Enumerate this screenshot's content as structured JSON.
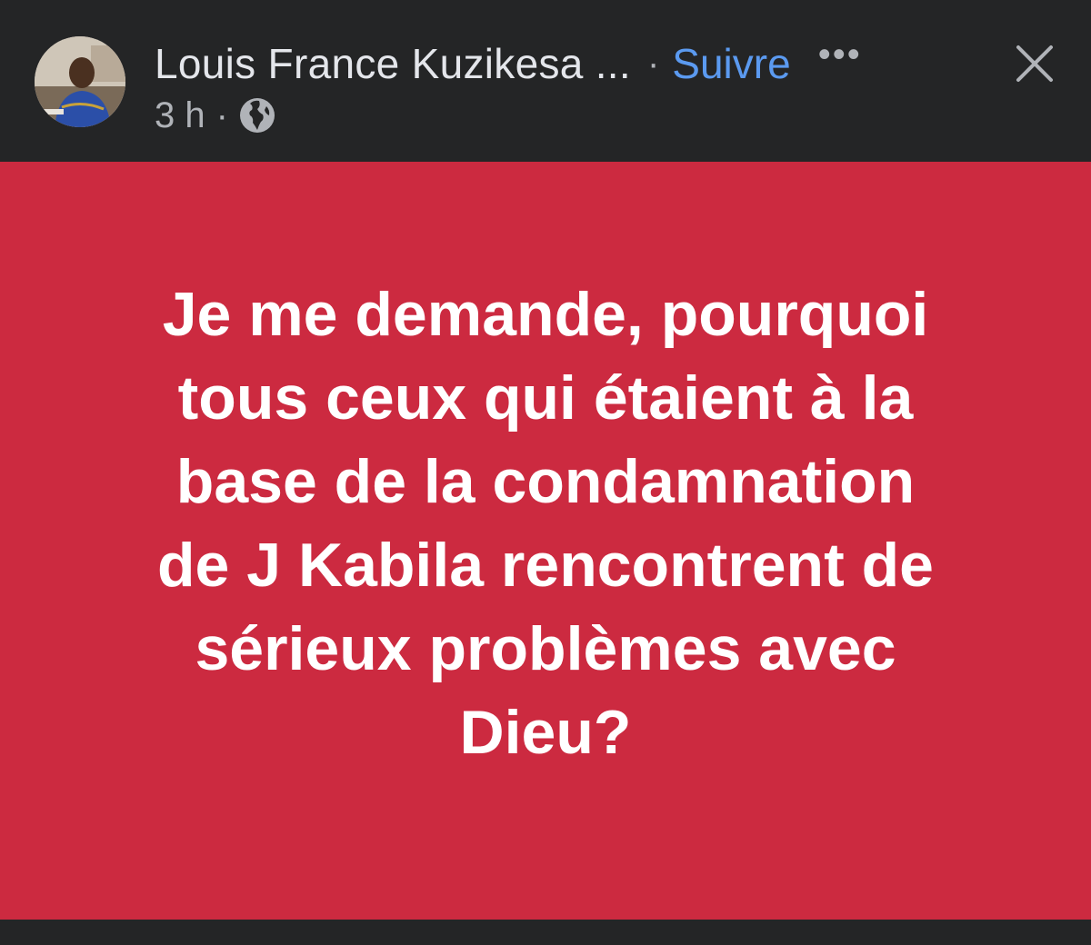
{
  "post": {
    "author_name": "Louis France Kuzikesa ...",
    "separator": "·",
    "follow_label": "Suivre",
    "more_label": "•••",
    "timestamp": "3 h",
    "meta_separator": "·",
    "privacy_icon": "globe-icon",
    "body_lines": [
      "Je me demande, pourquoi",
      "tous ceux qui étaient à la",
      "base de la condamnation",
      "de J Kabila rencontrent de",
      "sérieux problèmes avec",
      "Dieu?"
    ],
    "background_color": "#cc2a40",
    "text_color": "#ffffff"
  },
  "colors": {
    "app_background": "#242526",
    "link": "#5b9af0",
    "primary_text": "#e4e6eb",
    "secondary_text": "#b0b3b8"
  }
}
